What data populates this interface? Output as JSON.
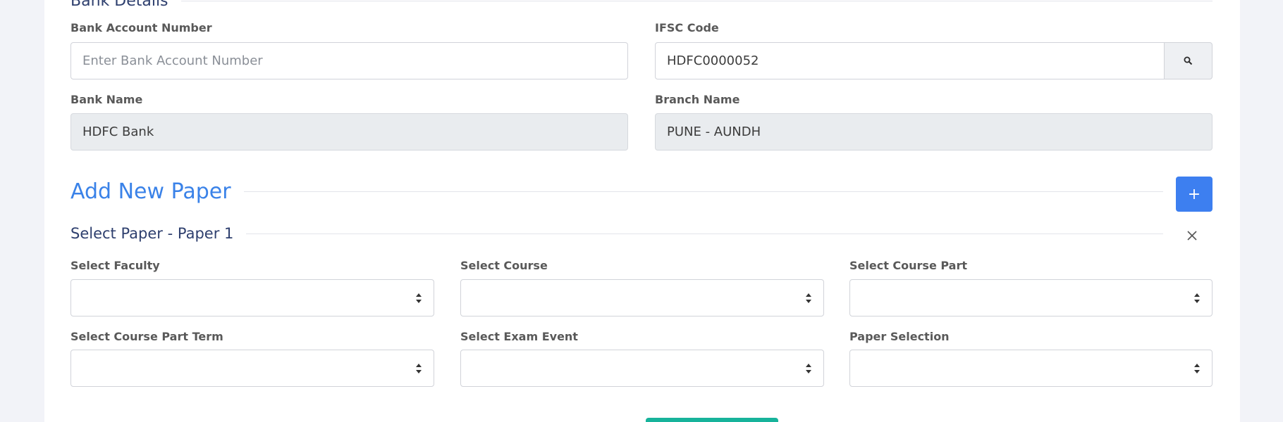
{
  "bank_details": {
    "title": "Bank Details",
    "account_number": {
      "label": "Bank Account Number",
      "value": "",
      "placeholder": "Enter Bank Account Number"
    },
    "ifsc": {
      "label": "IFSC Code",
      "value": "HDFC0000052"
    },
    "bank_name": {
      "label": "Bank Name",
      "value": "HDFC Bank"
    },
    "branch_name": {
      "label": "Branch Name",
      "value": "PUNE - AUNDH"
    }
  },
  "add_paper": {
    "title": "Add New Paper",
    "add_button_label": "+"
  },
  "paper": {
    "title": "Select Paper - Paper 1",
    "fields": [
      {
        "label": "Select Faculty",
        "value": ""
      },
      {
        "label": "Select Course",
        "value": ""
      },
      {
        "label": "Select Course Part",
        "value": ""
      },
      {
        "label": "Select Course Part Term",
        "value": ""
      },
      {
        "label": "Select Exam Event",
        "value": ""
      },
      {
        "label": "Paper Selection",
        "value": ""
      }
    ]
  },
  "icons": {
    "search": "search-icon",
    "remove": "close-icon",
    "select": "sort-arrows-icon"
  },
  "colors": {
    "accent_blue": "#3d7ff0",
    "title_blue": "#3a82e8",
    "heading_navy": "#2e3f6e",
    "submit_green": "#17b39b"
  }
}
